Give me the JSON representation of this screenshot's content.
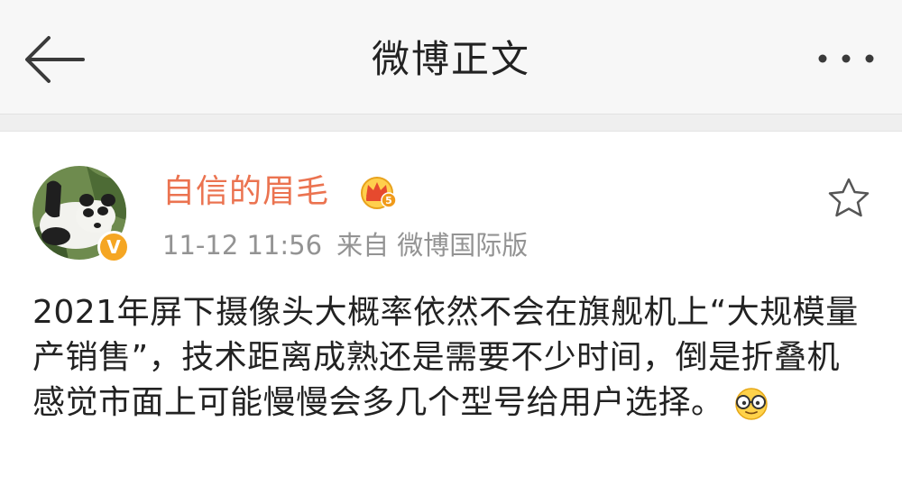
{
  "header": {
    "title": "微博正文",
    "back_icon": "arrow-left-icon",
    "more_icon": "more-dots-icon"
  },
  "post": {
    "author": {
      "name": "自信的眉毛",
      "avatar_icon": "panda-avatar",
      "verified_icon": "verified-v-icon",
      "verified_mark": "V",
      "vip_icon": "crown-level-5-icon"
    },
    "time": "11-12 11:56",
    "source": "来自 微博国际版",
    "text": "2021年屏下摄像头大概率依然不会在旗舰机上“大规模量产销售”，技术距离成熟还是需要不少时间，倒是折叠机感觉市面上可能慢慢会多几个型号给用户选择。",
    "emoji_icon": "glasses-emoji-icon",
    "favorite_icon": "star-outline-icon"
  },
  "colors": {
    "username": "#eb7350",
    "meta_text": "#939393",
    "header_bg": "#f7f7f7",
    "badge": "#f5a623"
  }
}
